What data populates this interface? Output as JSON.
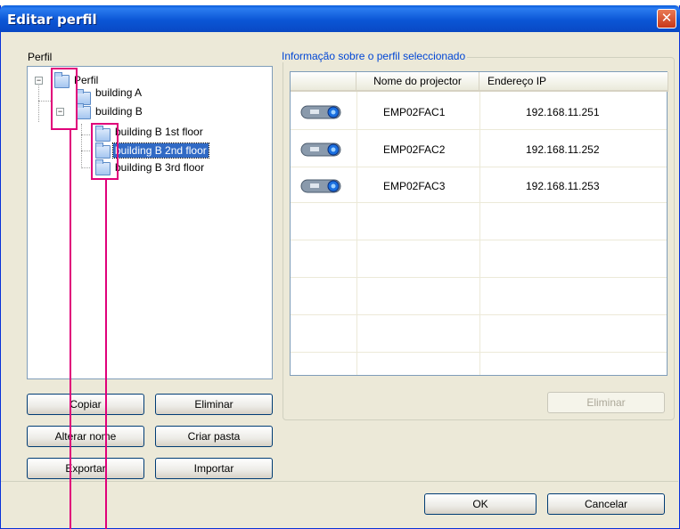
{
  "window": {
    "title": "Editar perfil",
    "close_icon": "close-icon"
  },
  "profile_panel": {
    "label": "Perfil",
    "tree": {
      "root": "Perfil",
      "items": [
        "building A",
        "building B",
        "building B 1st floor",
        "building B 2nd floor",
        "building B 3rd floor"
      ],
      "selected": "building B 2nd floor"
    },
    "buttons": {
      "copy": "Copiar",
      "delete": "Eliminar",
      "rename": "Alterar nome",
      "create_folder": "Criar pasta",
      "export": "Exportar",
      "import": "Importar"
    }
  },
  "info_panel": {
    "title": "Informação sobre o perfil seleccionado",
    "columns": [
      "",
      "Nome do projector",
      "Endereço IP"
    ],
    "rows": [
      {
        "icon": "projector-icon",
        "name": "EMP02FAC1",
        "ip": "192.168.11.251"
      },
      {
        "icon": "projector-icon",
        "name": "EMP02FAC2",
        "ip": "192.168.11.252"
      },
      {
        "icon": "projector-icon",
        "name": "EMP02FAC3",
        "ip": "192.168.11.253"
      }
    ],
    "delete_button": "Eliminar"
  },
  "footer": {
    "ok": "OK",
    "cancel": "Cancelar"
  },
  "colors": {
    "highlight": "#e0007a",
    "titlebar": "#0b56d6",
    "selection": "#316ac5"
  }
}
